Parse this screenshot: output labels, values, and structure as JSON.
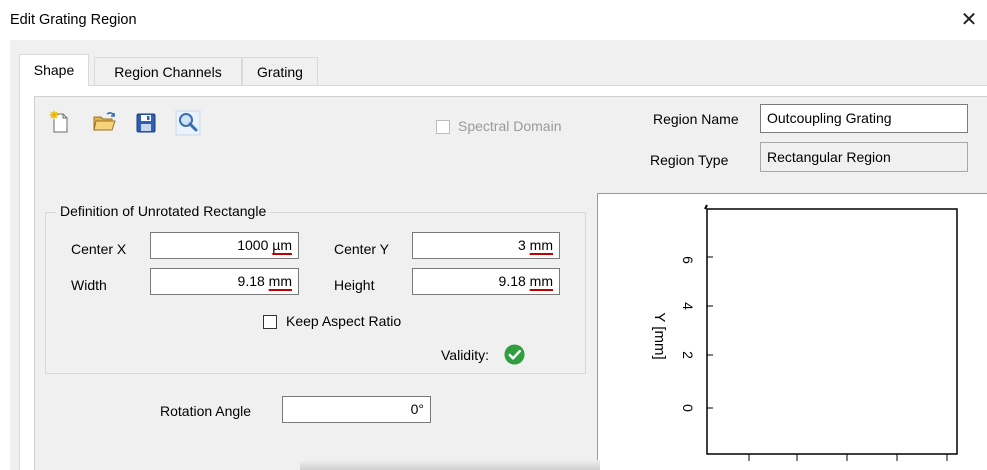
{
  "window": {
    "title": "Edit Grating Region",
    "close_icon": "close-icon"
  },
  "tabs": [
    {
      "label": "Shape",
      "active": true
    },
    {
      "label": "Region Channels",
      "active": false
    },
    {
      "label": "Grating",
      "active": false
    }
  ],
  "toolbar": {
    "icons": [
      "new-document-icon",
      "open-folder-icon",
      "save-disk-icon",
      "magnifier-icon"
    ]
  },
  "spectral_domain": {
    "label": "Spectral Domain",
    "checked": false,
    "enabled": false
  },
  "region": {
    "name_label": "Region Name",
    "name_value": "Outcoupling Grating",
    "type_label": "Region Type",
    "type_value": "Rectangular Region"
  },
  "definition": {
    "legend": "Definition of Unrotated Rectangle",
    "center_x": {
      "label": "Center X",
      "number": "1000",
      "unit": "µm"
    },
    "center_y": {
      "label": "Center Y",
      "number": "3",
      "unit": "mm"
    },
    "width": {
      "label": "Width",
      "number": "9.18",
      "unit": "mm"
    },
    "height": {
      "label": "Height",
      "number": "9.18",
      "unit": "mm"
    },
    "keep_aspect": {
      "label": "Keep Aspect Ratio",
      "checked": false
    },
    "validity": {
      "label": "Validity:",
      "status": "valid",
      "color": "#2e9e3e"
    }
  },
  "rotation": {
    "label": "Rotation Angle",
    "value": "0°"
  },
  "plot": {
    "ylabel": "Y [mm]",
    "yticks": [
      "0",
      "2",
      "4",
      "6"
    ]
  },
  "colors": {
    "accent_red": "#c00000",
    "validity_green": "#2e9e3e"
  }
}
